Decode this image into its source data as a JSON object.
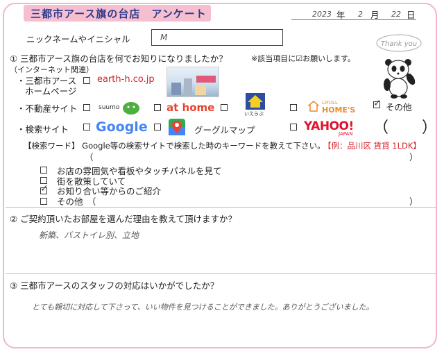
{
  "header": {
    "title": "三都市アース旗の台店　アンケート",
    "date": {
      "year": "2023",
      "year_unit": "年",
      "month": "2",
      "month_unit": "月",
      "day": "22",
      "day_unit": "日"
    },
    "thank_you": "Thank you"
  },
  "nickname": {
    "label": "ニックネームやイニシャル",
    "value": "M"
  },
  "q1": {
    "question": "① 三都市アース旗の台店を何でお知りになりましたか？",
    "note": "※該当項目に☑お願いします。",
    "internet_heading": "（インターネット関連）",
    "homepage_label_1": "・三都市アース",
    "homepage_label_2": "ホームページ",
    "homepage_url": "earth-h.co.jp",
    "realestate_label": "・不動産サイト",
    "search_label": "・検索サイト",
    "logos": {
      "suumo": "suumo",
      "athome": "at home",
      "ieshoppu": "いえらぶ",
      "lifull_top": "LIFULL",
      "lifull": "HOME'S",
      "google": "Google",
      "googlemap": "グーグルマップ",
      "yahoo": "YAHOO!",
      "yahoo_sub": "JAPAN"
    },
    "other_label": "その他",
    "other_paren_open": "（",
    "other_paren_close": "）",
    "search_word_text": "【検索ワード】 Google等の検索サイトで検索した時のキーワードを教えて下さい。",
    "search_word_example": "【例：品川区 賃貸 1LDK】",
    "paren_open": "（",
    "paren_close": "）",
    "offline_options": [
      {
        "label": "お店の雰囲気や看板やタッチパネルを見て",
        "checked": false
      },
      {
        "label": "街を散策していて",
        "checked": false
      },
      {
        "label": "お知り合い等からのご紹介",
        "checked": true
      },
      {
        "label": "その他　（",
        "checked": false
      }
    ],
    "offline_paren_close": "）",
    "checks": {
      "realestate_other": true
    },
    "check_mark": "✓"
  },
  "q2": {
    "question": "② ご契約頂いたお部屋を選んだ理由を教えて頂けますか？",
    "answer": "新築、バストイレ別、立地"
  },
  "q3": {
    "question": "③ 三都市アースのスタッフの対応はいかがでしたか？",
    "answer": "とても親切に対応して下さって、いい物件を見つけることができました。ありがとうございました。"
  }
}
